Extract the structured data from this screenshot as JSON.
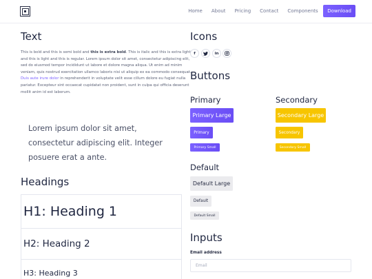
{
  "nav": {
    "links": [
      "Home",
      "About",
      "Pricing",
      "Contact",
      "Components"
    ],
    "cta": "Download"
  },
  "text_section": {
    "title": "Text",
    "bold": "This is bold and this is semi bold and",
    "extra_bold": "this is extra bold",
    "rest": ". This is italic and this is extra light and this is light and this is regular. Lorem ipsum dolor sit amet, consectetur adipiscing elit, sed do eiusmod tempor incididunt ut labore et dolore magna aliqua. Ut enim ad minim veniam, quis nostrud exercitation ullamco laboris nisi ut aliquip ex ea commodo consequat.",
    "link": "Duis aute irure dolor",
    "tail": "in reprehenderit in voluptate velit esse cillum dolore eu fugiat nulla pariatur. Excepteur sint occaecat cupidatat non proident, sunt in culpa qui officia deserunt mollit anim id est laborum.",
    "lead": "Lorem ipsum dolor sit amet, consectetur adipiscing elit. Integer posuere erat a ante."
  },
  "headings_section": {
    "title": "Headings",
    "h1": "H1: Heading 1",
    "h2": "H2: Heading 2",
    "h3": "H3: Heading 3"
  },
  "icons_section": {
    "title": "Icons",
    "icons": [
      "facebook-icon",
      "twitter-icon",
      "linkedin-icon",
      "instagram-icon"
    ]
  },
  "buttons_section": {
    "title": "Buttons",
    "primary": {
      "title": "Primary",
      "large": "Primary Large",
      "normal": "Primary",
      "small": "Primary Small"
    },
    "secondary": {
      "title": "Secondary",
      "large": "Secondary Large",
      "normal": "Secondary",
      "small": "Secondary Small"
    },
    "default": {
      "title": "Default",
      "large": "Default Large",
      "normal": "Default",
      "small": "Default Small"
    }
  },
  "inputs_section": {
    "title": "Inputs",
    "email_label": "Email address",
    "email_placeholder": "Email"
  },
  "colors": {
    "primary": "#7b61ff",
    "secondary": "#f7c500",
    "default": "#ebebee",
    "text": "#1f2640"
  }
}
